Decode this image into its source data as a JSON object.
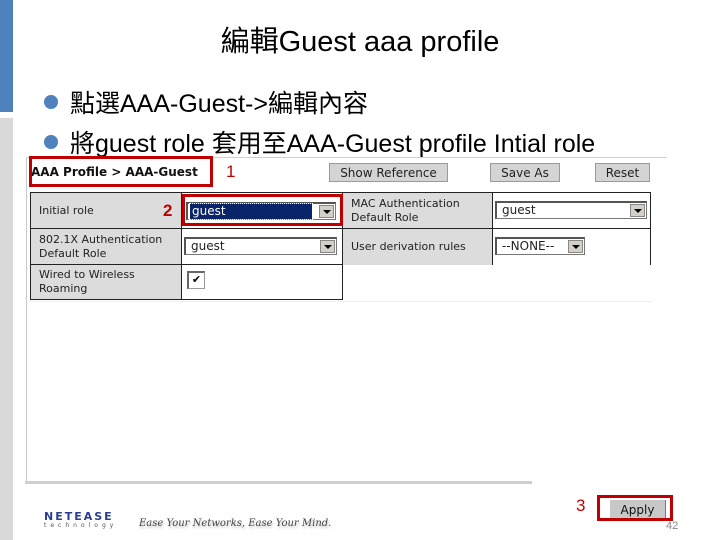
{
  "slide": {
    "title": "編輯Guest aaa profile",
    "bullets": [
      "點選AAA-Guest->編輯內容",
      "將guest role 套用至AAA-Guest profile Intial role"
    ],
    "page_number": "42",
    "accent_color": "#4f81bd",
    "highlight_color": "#c00000"
  },
  "screenshot": {
    "breadcrumb": "AAA Profile > AAA-Guest",
    "buttons": {
      "show_reference": "Show Reference",
      "save_as": "Save As",
      "reset": "Reset",
      "apply": "Apply"
    },
    "left_table": [
      {
        "label": "Initial role",
        "type": "select",
        "value": "guest",
        "active": true
      },
      {
        "label": "802.1X Authentication Default Role",
        "type": "select",
        "value": "guest"
      },
      {
        "label": "Wired to Wireless Roaming",
        "type": "checkbox",
        "checked": true
      }
    ],
    "right_table": [
      {
        "label": "MAC Authentication Default Role",
        "type": "select",
        "value": "guest"
      },
      {
        "label": "User derivation rules",
        "type": "select",
        "value": "--NONE--"
      }
    ],
    "checkbox_mark": "✔"
  },
  "annotations": {
    "step1": "1",
    "step2": "2",
    "step3": "3"
  },
  "footer": {
    "logo_main": "NETEASE",
    "logo_sub": "technology",
    "tagline": "Ease Your Networks, Ease Your Mind."
  }
}
